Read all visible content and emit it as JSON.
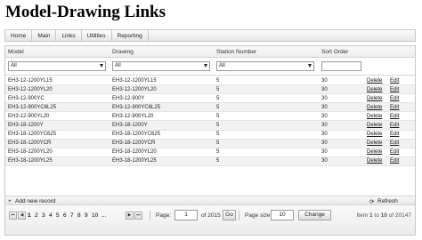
{
  "page": {
    "title": "Model-Drawing Links"
  },
  "menu": [
    "Home",
    "Main",
    "Links",
    "Utilities",
    "Reporting"
  ],
  "grid": {
    "columns": [
      "Model",
      "Drawing",
      "Station Number",
      "Sort Order"
    ],
    "filters": {
      "model": "All",
      "drawing": "All",
      "station": "All",
      "sort_order": ""
    },
    "rows": [
      {
        "model": "EH3-12-1200YL15",
        "drawing": "EH3-12-1200YL15",
        "station": "5",
        "sort": "30"
      },
      {
        "model": "EH3-12-1200YL20",
        "drawing": "EH3-12-1200YL20",
        "station": "5",
        "sort": "30"
      },
      {
        "model": "EH3-12-900YC",
        "drawing": "EH3-12-900Y",
        "station": "5",
        "sort": "30"
      },
      {
        "model": "EH3-12-900YC6L25",
        "drawing": "EH3-12-900YC6L25",
        "station": "5",
        "sort": "30"
      },
      {
        "model": "EH3-12-900YL20",
        "drawing": "EH3-12-900YL20",
        "station": "5",
        "sort": "30"
      },
      {
        "model": "EH3-18-1200Y",
        "drawing": "EH3-18-1200Y",
        "station": "5",
        "sort": "30"
      },
      {
        "model": "EH3-18-1200YC625",
        "drawing": "EH3-18-1200YC625",
        "station": "5",
        "sort": "30"
      },
      {
        "model": "EH3-18-1200YCR",
        "drawing": "EH3-18-1200YCR",
        "station": "5",
        "sort": "30"
      },
      {
        "model": "EH3-18-1200YL20",
        "drawing": "EH3-18-1200YL20",
        "station": "5",
        "sort": "30"
      },
      {
        "model": "EH3-18-1200YL25",
        "drawing": "EH3-18-1200YL25",
        "station": "5",
        "sort": "30"
      }
    ],
    "delete_label": "Delete",
    "edit_label": "Edit",
    "add_label": "Add new record",
    "refresh_label": "Refresh"
  },
  "pager": {
    "first": "⏮",
    "prev": "◀",
    "next": "▶",
    "last": "⏭",
    "pages": [
      "1",
      "2",
      "3",
      "4",
      "5",
      "6",
      "7",
      "8",
      "9",
      "10",
      "..."
    ],
    "page_label": "Page:",
    "page_value": "1",
    "of_label": "of 2015",
    "go_label": "Go",
    "size_label": "Page size:",
    "size_value": "10",
    "change_label": "Change",
    "info_prefix": "Item",
    "info_start": "1",
    "info_to": "to",
    "info_end": "10",
    "info_of": "of 20147"
  }
}
